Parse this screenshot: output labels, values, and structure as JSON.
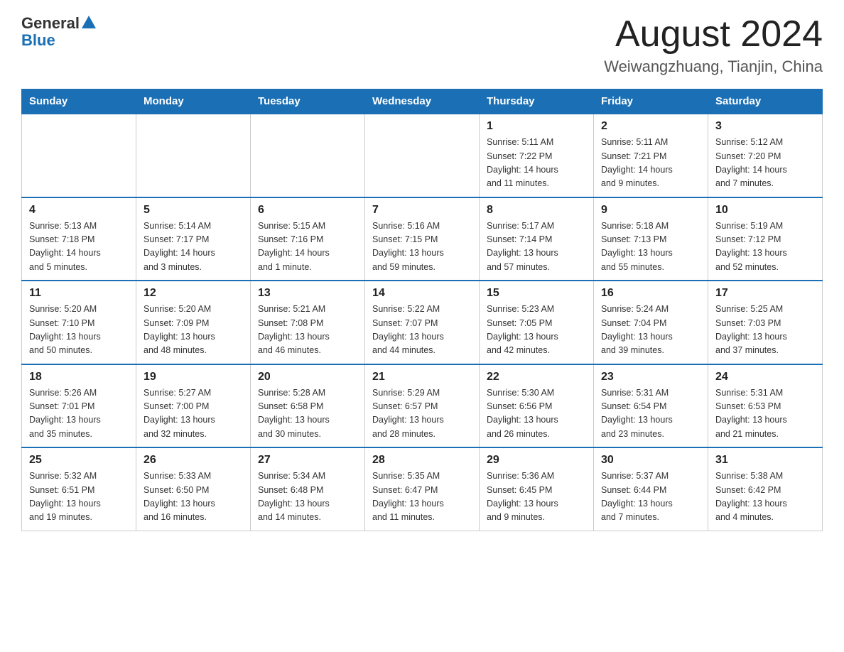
{
  "header": {
    "logo_general": "General",
    "logo_blue": "Blue",
    "month_title": "August 2024",
    "location": "Weiwangzhuang, Tianjin, China"
  },
  "weekdays": [
    "Sunday",
    "Monday",
    "Tuesday",
    "Wednesday",
    "Thursday",
    "Friday",
    "Saturday"
  ],
  "weeks": [
    [
      {
        "day": "",
        "info": ""
      },
      {
        "day": "",
        "info": ""
      },
      {
        "day": "",
        "info": ""
      },
      {
        "day": "",
        "info": ""
      },
      {
        "day": "1",
        "info": "Sunrise: 5:11 AM\nSunset: 7:22 PM\nDaylight: 14 hours\nand 11 minutes."
      },
      {
        "day": "2",
        "info": "Sunrise: 5:11 AM\nSunset: 7:21 PM\nDaylight: 14 hours\nand 9 minutes."
      },
      {
        "day": "3",
        "info": "Sunrise: 5:12 AM\nSunset: 7:20 PM\nDaylight: 14 hours\nand 7 minutes."
      }
    ],
    [
      {
        "day": "4",
        "info": "Sunrise: 5:13 AM\nSunset: 7:18 PM\nDaylight: 14 hours\nand 5 minutes."
      },
      {
        "day": "5",
        "info": "Sunrise: 5:14 AM\nSunset: 7:17 PM\nDaylight: 14 hours\nand 3 minutes."
      },
      {
        "day": "6",
        "info": "Sunrise: 5:15 AM\nSunset: 7:16 PM\nDaylight: 14 hours\nand 1 minute."
      },
      {
        "day": "7",
        "info": "Sunrise: 5:16 AM\nSunset: 7:15 PM\nDaylight: 13 hours\nand 59 minutes."
      },
      {
        "day": "8",
        "info": "Sunrise: 5:17 AM\nSunset: 7:14 PM\nDaylight: 13 hours\nand 57 minutes."
      },
      {
        "day": "9",
        "info": "Sunrise: 5:18 AM\nSunset: 7:13 PM\nDaylight: 13 hours\nand 55 minutes."
      },
      {
        "day": "10",
        "info": "Sunrise: 5:19 AM\nSunset: 7:12 PM\nDaylight: 13 hours\nand 52 minutes."
      }
    ],
    [
      {
        "day": "11",
        "info": "Sunrise: 5:20 AM\nSunset: 7:10 PM\nDaylight: 13 hours\nand 50 minutes."
      },
      {
        "day": "12",
        "info": "Sunrise: 5:20 AM\nSunset: 7:09 PM\nDaylight: 13 hours\nand 48 minutes."
      },
      {
        "day": "13",
        "info": "Sunrise: 5:21 AM\nSunset: 7:08 PM\nDaylight: 13 hours\nand 46 minutes."
      },
      {
        "day": "14",
        "info": "Sunrise: 5:22 AM\nSunset: 7:07 PM\nDaylight: 13 hours\nand 44 minutes."
      },
      {
        "day": "15",
        "info": "Sunrise: 5:23 AM\nSunset: 7:05 PM\nDaylight: 13 hours\nand 42 minutes."
      },
      {
        "day": "16",
        "info": "Sunrise: 5:24 AM\nSunset: 7:04 PM\nDaylight: 13 hours\nand 39 minutes."
      },
      {
        "day": "17",
        "info": "Sunrise: 5:25 AM\nSunset: 7:03 PM\nDaylight: 13 hours\nand 37 minutes."
      }
    ],
    [
      {
        "day": "18",
        "info": "Sunrise: 5:26 AM\nSunset: 7:01 PM\nDaylight: 13 hours\nand 35 minutes."
      },
      {
        "day": "19",
        "info": "Sunrise: 5:27 AM\nSunset: 7:00 PM\nDaylight: 13 hours\nand 32 minutes."
      },
      {
        "day": "20",
        "info": "Sunrise: 5:28 AM\nSunset: 6:58 PM\nDaylight: 13 hours\nand 30 minutes."
      },
      {
        "day": "21",
        "info": "Sunrise: 5:29 AM\nSunset: 6:57 PM\nDaylight: 13 hours\nand 28 minutes."
      },
      {
        "day": "22",
        "info": "Sunrise: 5:30 AM\nSunset: 6:56 PM\nDaylight: 13 hours\nand 26 minutes."
      },
      {
        "day": "23",
        "info": "Sunrise: 5:31 AM\nSunset: 6:54 PM\nDaylight: 13 hours\nand 23 minutes."
      },
      {
        "day": "24",
        "info": "Sunrise: 5:31 AM\nSunset: 6:53 PM\nDaylight: 13 hours\nand 21 minutes."
      }
    ],
    [
      {
        "day": "25",
        "info": "Sunrise: 5:32 AM\nSunset: 6:51 PM\nDaylight: 13 hours\nand 19 minutes."
      },
      {
        "day": "26",
        "info": "Sunrise: 5:33 AM\nSunset: 6:50 PM\nDaylight: 13 hours\nand 16 minutes."
      },
      {
        "day": "27",
        "info": "Sunrise: 5:34 AM\nSunset: 6:48 PM\nDaylight: 13 hours\nand 14 minutes."
      },
      {
        "day": "28",
        "info": "Sunrise: 5:35 AM\nSunset: 6:47 PM\nDaylight: 13 hours\nand 11 minutes."
      },
      {
        "day": "29",
        "info": "Sunrise: 5:36 AM\nSunset: 6:45 PM\nDaylight: 13 hours\nand 9 minutes."
      },
      {
        "day": "30",
        "info": "Sunrise: 5:37 AM\nSunset: 6:44 PM\nDaylight: 13 hours\nand 7 minutes."
      },
      {
        "day": "31",
        "info": "Sunrise: 5:38 AM\nSunset: 6:42 PM\nDaylight: 13 hours\nand 4 minutes."
      }
    ]
  ]
}
